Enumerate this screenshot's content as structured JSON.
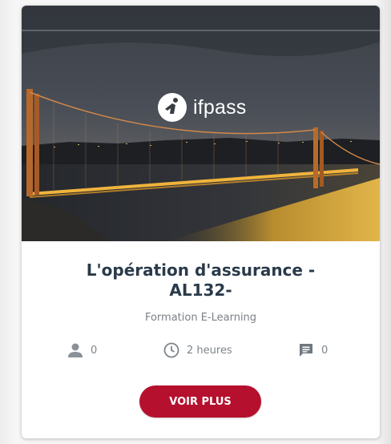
{
  "course_card": {
    "logo_text": "ifpass",
    "title_line1": "L'opération d'assurance -",
    "title_line2": "AL132-",
    "subtitle": "Formation E-Learning",
    "learners_count": "0",
    "duration": "2 heures",
    "comments_count": "0",
    "cta_label": "VOIR PLUS",
    "icons": [
      "person-icon",
      "clock-icon",
      "comment-icon"
    ],
    "colors": {
      "title": "#2a3a4a",
      "meta": "#7d858c",
      "button": "#b5102e"
    }
  }
}
